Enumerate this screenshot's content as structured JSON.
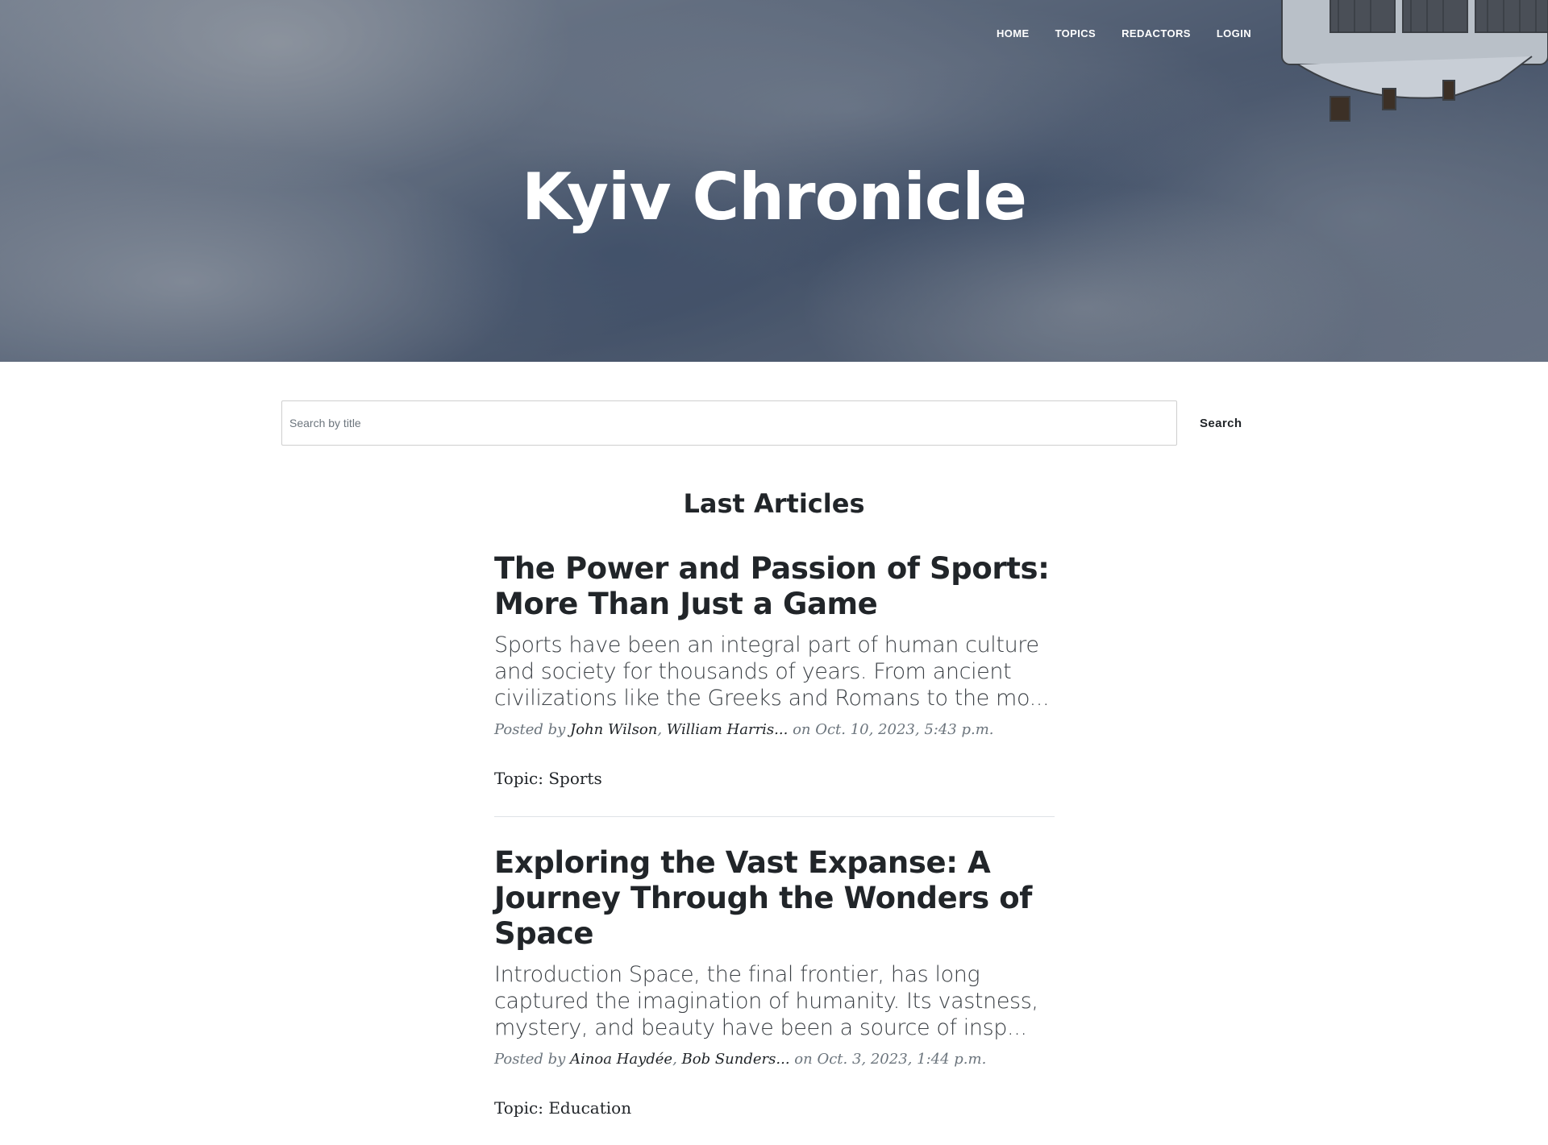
{
  "nav": {
    "items": [
      {
        "label": "HOME"
      },
      {
        "label": "TOPICS"
      },
      {
        "label": "REDACTORS"
      },
      {
        "label": "LOGIN"
      }
    ]
  },
  "site": {
    "title": "Kyiv Chronicle"
  },
  "search": {
    "placeholder": "Search by title",
    "button_label": "Search"
  },
  "articles": {
    "heading": "Last Articles",
    "items": [
      {
        "title": "The Power and Passion of Sports: More Than Just a Game",
        "subtitle": "Sports have been an integral part of human culture and society for thousands of years. From ancient civilizations like the Greeks and Romans to the mo...",
        "posted_by": "Posted by",
        "authors": [
          "John Wilson",
          "William Harris..."
        ],
        "on": "on Oct. 10, 2023, 5:43 p.m.",
        "topic": "Topic: Sports"
      },
      {
        "title": "Exploring the Vast Expanse: A Journey Through the Wonders of Space",
        "subtitle": "Introduction Space, the final frontier, has long captured the imagination of humanity. Its vastness, mystery, and beauty have been a source of insp...",
        "posted_by": "Posted by",
        "authors": [
          "Ainoa Haydée",
          "Bob Sunders..."
        ],
        "on": "on Oct. 3, 2023, 1:44 p.m.",
        "topic": "Topic: Education"
      }
    ]
  },
  "colors": {
    "text": "#212529",
    "meta": "#6c757d",
    "overlay": "#212529",
    "divider": "#dee2e6"
  },
  "icons": {
    "station": "space-station-image"
  }
}
